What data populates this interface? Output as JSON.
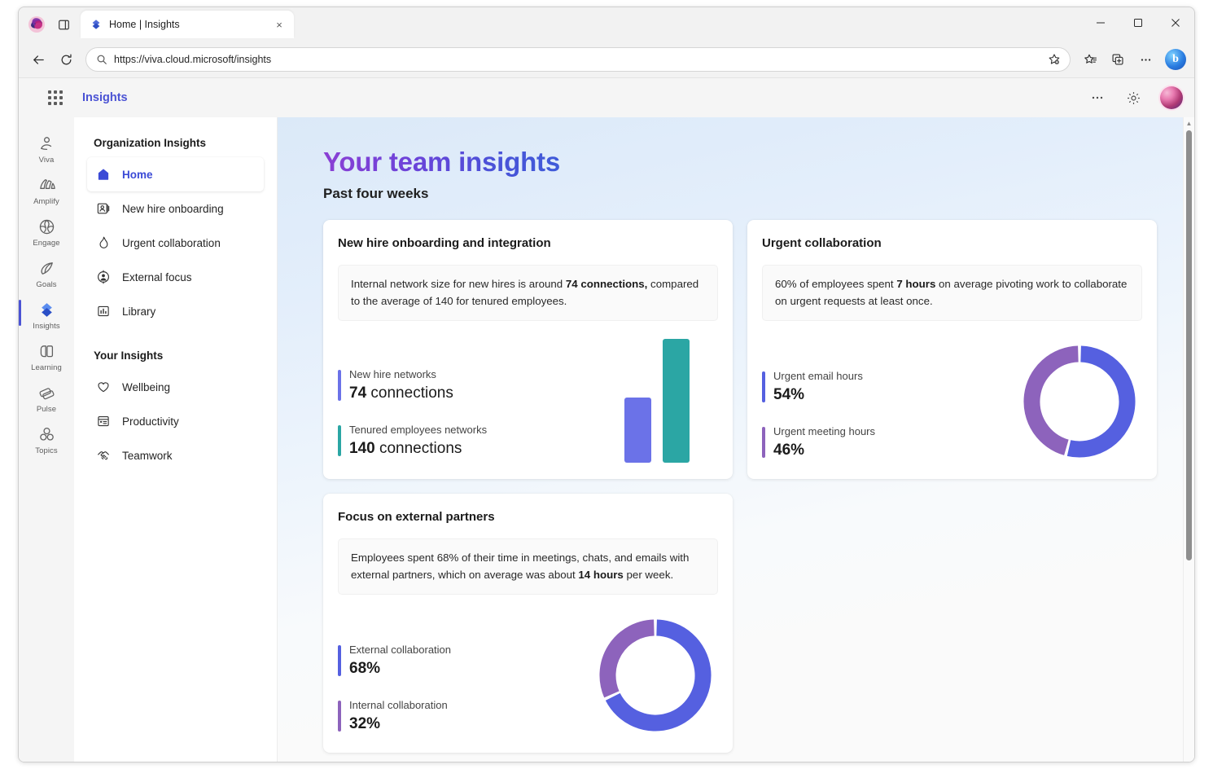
{
  "browser": {
    "tab": {
      "title": "Home | Insights",
      "close_label": "×",
      "favicon": "insights-diamond-icon"
    },
    "window_controls": {
      "minimize": "–",
      "maximize": "□",
      "close": "✕"
    },
    "toolbar": {
      "back_label": "←",
      "refresh_label": "⟳",
      "search_icon": "search-icon",
      "url": "https://viva.cloud.microsoft/insights",
      "favorite_icon": "favorite-star-icon",
      "favorites_bar_icon": "favorites-list-icon",
      "collections_icon": "collections-icon",
      "settings_more_icon": "more-options-icon",
      "copilot_label": "b"
    },
    "tab_list_icon": "tab-actions-icon"
  },
  "appbar": {
    "waffle_icon": "app-launcher-icon",
    "title": "Insights",
    "more_label": "⋯",
    "settings_icon": "gear-icon",
    "avatar_icon": "user-avatar"
  },
  "rail": {
    "items": [
      {
        "label": "Viva",
        "icon": "viva-person-icon",
        "active": false
      },
      {
        "label": "Amplify",
        "icon": "amplify-icon",
        "active": false
      },
      {
        "label": "Engage",
        "icon": "engage-icon",
        "active": false
      },
      {
        "label": "Goals",
        "icon": "goals-icon",
        "active": false
      },
      {
        "label": "Insights",
        "icon": "insights-diamond-icon",
        "active": true
      },
      {
        "label": "Learning",
        "icon": "learning-icon",
        "active": false
      },
      {
        "label": "Pulse",
        "icon": "pulse-icon",
        "active": false
      },
      {
        "label": "Topics",
        "icon": "topics-icon",
        "active": false
      }
    ]
  },
  "subnav": {
    "section1_title": "Organization Insights",
    "section1_items": [
      {
        "label": "Home",
        "icon": "home-icon",
        "active": true
      },
      {
        "label": "New hire onboarding",
        "icon": "contact-card-icon",
        "active": false
      },
      {
        "label": "Urgent collaboration",
        "icon": "flame-icon",
        "active": false
      },
      {
        "label": "External focus",
        "icon": "person-circle-icon",
        "active": false
      },
      {
        "label": "Library",
        "icon": "bar-chart-icon",
        "active": false
      }
    ],
    "section2_title": "Your Insights",
    "section2_items": [
      {
        "label": "Wellbeing",
        "icon": "heart-icon",
        "active": false
      },
      {
        "label": "Productivity",
        "icon": "calendar-icon",
        "active": false
      },
      {
        "label": "Teamwork",
        "icon": "handshake-icon",
        "active": false
      }
    ]
  },
  "main": {
    "title": "Your team insights",
    "subtitle": "Past four weeks"
  },
  "colors": {
    "blue": "#6b72e8",
    "indigo": "#5560e0",
    "teal": "#2ba6a4",
    "purple": "#8d63bc",
    "brand": "#4b53d4",
    "title_gradient_start": "#8b3fd4",
    "title_gradient_end": "#3f5bd9"
  },
  "cards": [
    {
      "id": "new-hire-onboarding",
      "title": "New hire onboarding and integration",
      "callout_parts": [
        {
          "text": "Internal network size for new hires is around ",
          "bold": false
        },
        {
          "text": "74 connections,",
          "bold": true
        },
        {
          "text": " compared to the average of 140 for tenured employees.",
          "bold": false
        }
      ],
      "callout_text": "Internal network size for new hires is around 74 connections, compared to the average of 140 for tenured employees.",
      "stats": [
        {
          "label": "New hire networks",
          "value": "74",
          "unit": "connections",
          "accent": "#6b72e8"
        },
        {
          "label": "Tenured employees networks",
          "value": "140",
          "unit": "connections",
          "accent": "#2ba6a4"
        }
      ]
    },
    {
      "id": "urgent-collaboration",
      "title": "Urgent collaboration",
      "callout_parts": [
        {
          "text": "60% of employees spent ",
          "bold": false
        },
        {
          "text": "7 hours",
          "bold": true
        },
        {
          "text": " on average pivoting work to collaborate on urgent requests at least once.",
          "bold": false
        }
      ],
      "callout_text": "60% of employees spent 7 hours on average pivoting work to collaborate on urgent requests at least once.",
      "stats": [
        {
          "label": "Urgent email hours",
          "value": "54%",
          "unit": "",
          "accent": "#5560e0"
        },
        {
          "label": "Urgent meeting hours",
          "value": "46%",
          "unit": "",
          "accent": "#8d63bc"
        }
      ]
    },
    {
      "id": "focus-on-external-partners",
      "title": "Focus on external partners",
      "callout_parts": [
        {
          "text": "Employees spent 68% of their time in meetings, chats, and emails with external partners, which on average was about ",
          "bold": false
        },
        {
          "text": "14 hours",
          "bold": true
        },
        {
          "text": " per week.",
          "bold": false
        }
      ],
      "callout_text": "Employees spent 68% of their time in meetings, chats, and emails with external partners, which on average was about 14 hours per week.",
      "stats": [
        {
          "label": "External collaboration",
          "value": "68%",
          "unit": "",
          "accent": "#5560e0"
        },
        {
          "label": "Internal collaboration",
          "value": "32%",
          "unit": "",
          "accent": "#8d63bc"
        }
      ]
    }
  ],
  "chart_data": [
    {
      "type": "bar",
      "id": "new-hire-networks-bar",
      "title": "New hire onboarding and integration",
      "categories": [
        "New hire networks",
        "Tenured employees networks"
      ],
      "values": [
        74,
        140
      ],
      "colors": [
        "#6b72e8",
        "#2ba6a4"
      ],
      "unit": "connections",
      "ylim": [
        0,
        140
      ],
      "grid": false,
      "legend": "left-labels",
      "xlabel": "",
      "ylabel": ""
    },
    {
      "type": "pie",
      "id": "urgent-collaboration-donut",
      "title": "Urgent collaboration",
      "labels": [
        "Urgent email hours",
        "Urgent meeting hours"
      ],
      "values": [
        54,
        46
      ],
      "colors": [
        "#5560e0",
        "#8d63bc"
      ],
      "unit": "%",
      "donut": true,
      "start_angle_deg": 0,
      "legend": "left-labels"
    },
    {
      "type": "pie",
      "id": "external-partners-donut",
      "title": "Focus on external partners",
      "labels": [
        "External collaboration",
        "Internal collaboration"
      ],
      "values": [
        68,
        32
      ],
      "colors": [
        "#5560e0",
        "#8d63bc"
      ],
      "unit": "%",
      "donut": true,
      "start_angle_deg": 0,
      "legend": "left-labels"
    }
  ]
}
